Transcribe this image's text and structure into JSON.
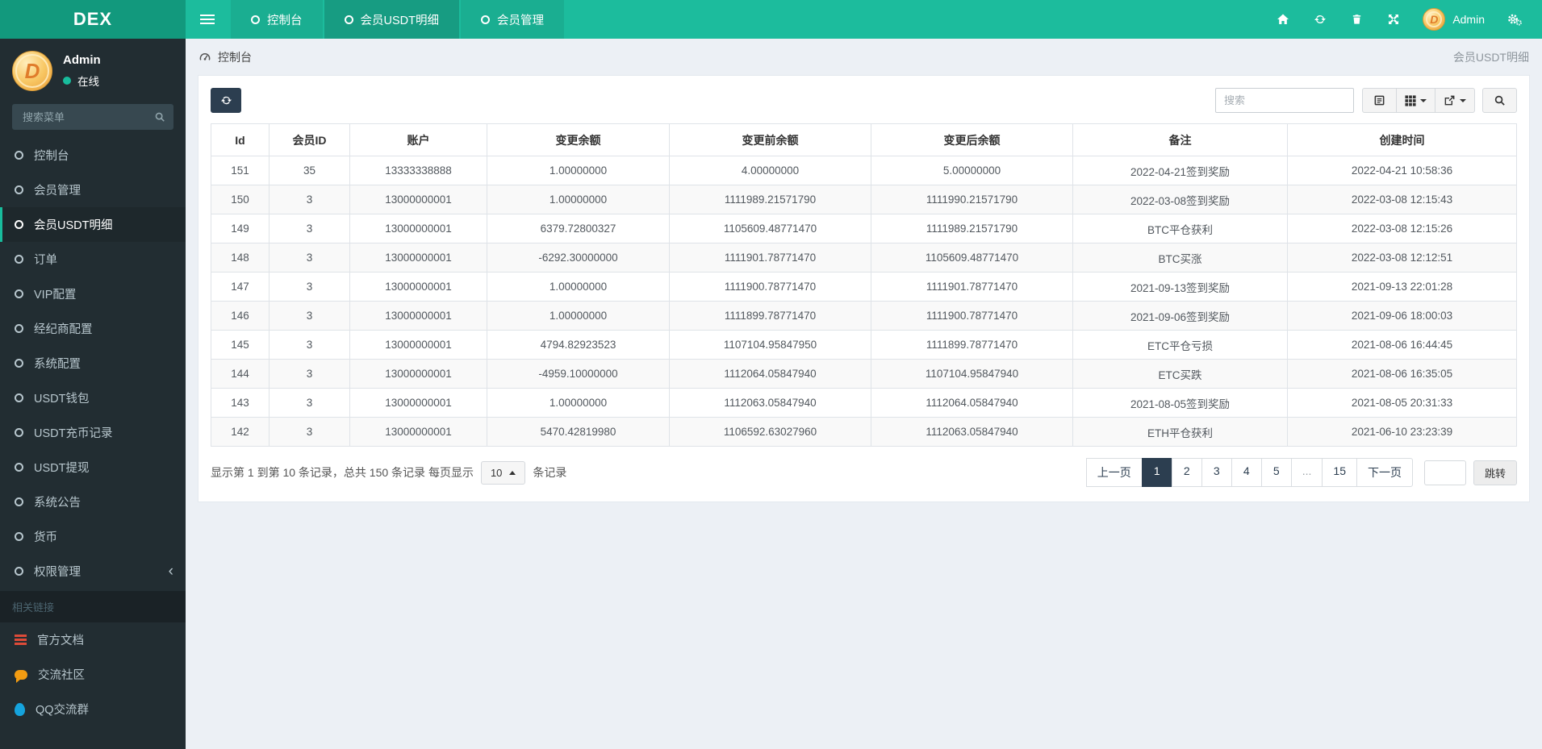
{
  "colors": {
    "navbar_teal": "#1cbc9d",
    "brand_bg": "#12997d",
    "sidebar_dark": "#222d32",
    "accent_teal": "#18bc9c",
    "primary_navy": "#2c3e50",
    "doc_icon_red": "#dd4b39",
    "chat_icon_orange": "#f39c12",
    "qq_icon_blue": "#15a3dd",
    "online_dot_green": "#18bc9c"
  },
  "icons": {
    "hamburger-icon": "three-bars",
    "circle-icon": "circle-outline",
    "home-icon": "house",
    "refresh-icon": "sync-arrows",
    "trash-icon": "trash-bin",
    "expand-icon": "arrows-alt",
    "cogs-icon": "gears",
    "search-icon": "magnifier",
    "dashboard-icon": "gauge",
    "detail-view-icon": "list-alt",
    "columns-icon": "grid-th",
    "export-icon": "arrow-out-of-box",
    "caret-down-icon": "triangle-down",
    "caret-up-icon": "triangle-up",
    "chevron-left-icon": "angle-left"
  },
  "navbar": {
    "brand": "DEX",
    "tabs": [
      {
        "label": "控制台"
      },
      {
        "label": "会员USDT明细",
        "active": true
      },
      {
        "label": "会员管理"
      }
    ],
    "user_name": "Admin"
  },
  "sidebar": {
    "user": {
      "name": "Admin",
      "status": "在线"
    },
    "search_placeholder": "搜索菜单",
    "menu": [
      {
        "label": "控制台"
      },
      {
        "label": "会员管理"
      },
      {
        "label": "会员USDT明细",
        "active": true
      },
      {
        "label": "订单"
      },
      {
        "label": "VIP配置"
      },
      {
        "label": "经纪商配置"
      },
      {
        "label": "系统配置"
      },
      {
        "label": "USDT钱包"
      },
      {
        "label": "USDT充币记录"
      },
      {
        "label": "USDT提现"
      },
      {
        "label": "系统公告"
      },
      {
        "label": "货币"
      },
      {
        "label": "权限管理",
        "chevron": true
      }
    ],
    "section_header": "相关链接",
    "links": [
      {
        "label": "官方文档"
      },
      {
        "label": "交流社区"
      },
      {
        "label": "QQ交流群"
      }
    ]
  },
  "breadcrumb": {
    "home": "控制台",
    "page_title": "会员USDT明细"
  },
  "toolbar": {
    "search_placeholder": "搜索"
  },
  "table": {
    "columns": [
      "Id",
      "会员ID",
      "账户",
      "变更余额",
      "变更前余额",
      "变更后余额",
      "备注",
      "创建时间"
    ],
    "rows": [
      [
        "151",
        "35",
        "13333338888",
        "1.00000000",
        "4.00000000",
        "5.00000000",
        "2022-04-21签到奖励",
        "2022-04-21 10:58:36"
      ],
      [
        "150",
        "3",
        "13000000001",
        "1.00000000",
        "1111989.21571790",
        "1111990.21571790",
        "2022-03-08签到奖励",
        "2022-03-08 12:15:43"
      ],
      [
        "149",
        "3",
        "13000000001",
        "6379.72800327",
        "1105609.48771470",
        "1111989.21571790",
        "BTC平仓获利",
        "2022-03-08 12:15:26"
      ],
      [
        "148",
        "3",
        "13000000001",
        "-6292.30000000",
        "1111901.78771470",
        "1105609.48771470",
        "BTC买涨",
        "2022-03-08 12:12:51"
      ],
      [
        "147",
        "3",
        "13000000001",
        "1.00000000",
        "1111900.78771470",
        "1111901.78771470",
        "2021-09-13签到奖励",
        "2021-09-13 22:01:28"
      ],
      [
        "146",
        "3",
        "13000000001",
        "1.00000000",
        "1111899.78771470",
        "1111900.78771470",
        "2021-09-06签到奖励",
        "2021-09-06 18:00:03"
      ],
      [
        "145",
        "3",
        "13000000001",
        "4794.82923523",
        "1107104.95847950",
        "1111899.78771470",
        "ETC平仓亏损",
        "2021-08-06 16:44:45"
      ],
      [
        "144",
        "3",
        "13000000001",
        "-4959.10000000",
        "1112064.05847940",
        "1107104.95847940",
        "ETC买跌",
        "2021-08-06 16:35:05"
      ],
      [
        "143",
        "3",
        "13000000001",
        "1.00000000",
        "1112063.05847940",
        "1112064.05847940",
        "2021-08-05签到奖励",
        "2021-08-05 20:31:33"
      ],
      [
        "142",
        "3",
        "13000000001",
        "5470.42819980",
        "1106592.63027960",
        "1112063.05847940",
        "ETH平仓获利",
        "2021-06-10 23:23:39"
      ]
    ]
  },
  "pagination": {
    "summary_prefix": "显示第 1 到第 10 条记录，总共 150 条记录 每页显示",
    "page_size": "10",
    "summary_suffix": "条记录",
    "pages": [
      {
        "label": "上一页"
      },
      {
        "label": "1",
        "active": true
      },
      {
        "label": "2"
      },
      {
        "label": "3"
      },
      {
        "label": "4"
      },
      {
        "label": "5"
      },
      {
        "label": "...",
        "ellipsis": true
      },
      {
        "label": "15"
      },
      {
        "label": "下一页"
      }
    ],
    "jump_label": "跳转"
  }
}
